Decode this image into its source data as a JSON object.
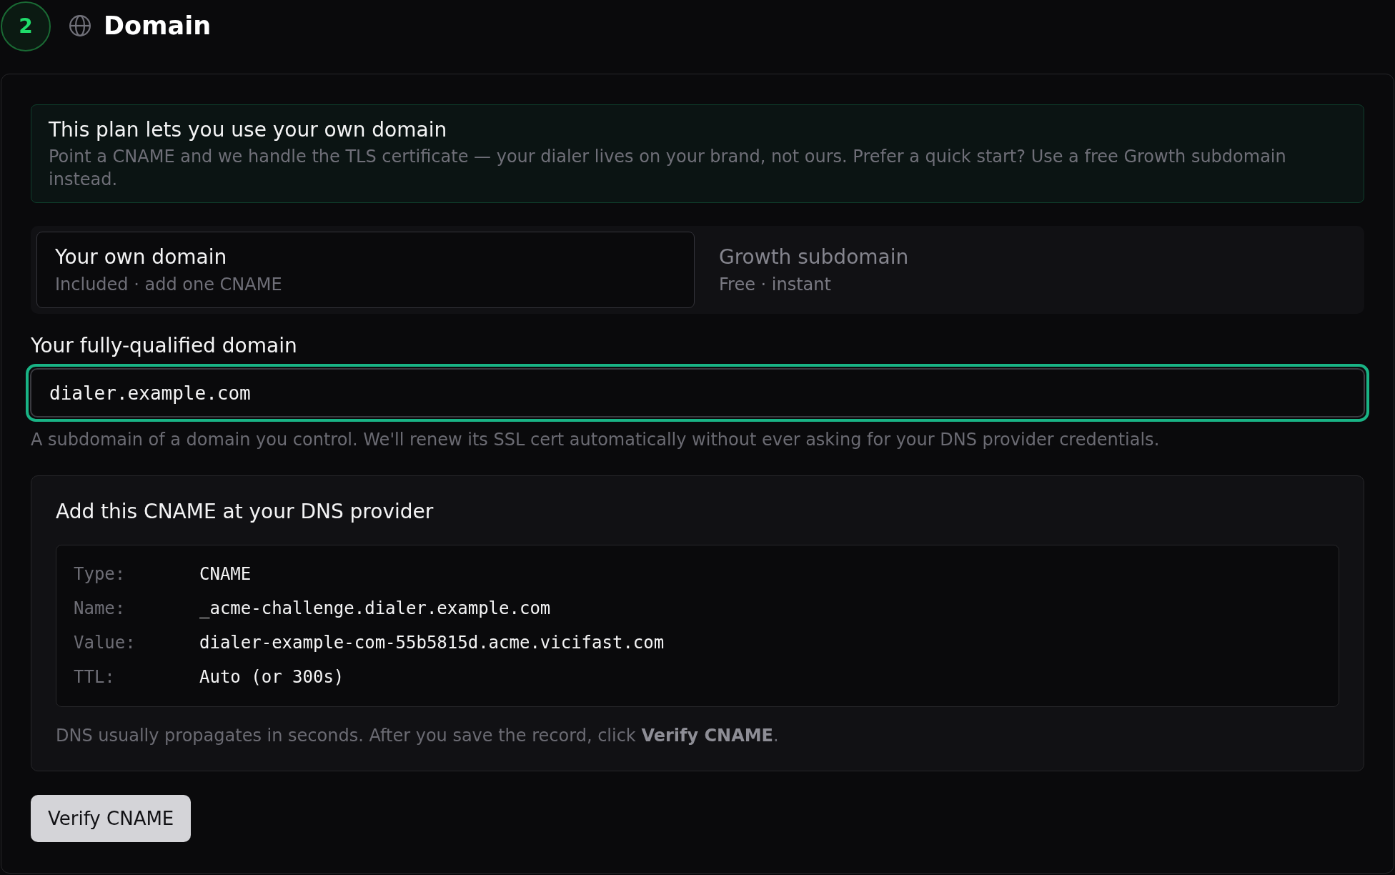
{
  "step": {
    "number": "2",
    "title": "Domain"
  },
  "notice": {
    "title": "This plan lets you use your own domain",
    "body": "Point a CNAME and we handle the TLS certificate — your dialer lives on your brand, not ours. Prefer a quick start? Use a free Growth subdomain instead."
  },
  "options": [
    {
      "title": "Your own domain",
      "subtitle": "Included · add one CNAME",
      "selected": true
    },
    {
      "title": "Growth subdomain",
      "subtitle": "Free · instant",
      "selected": false
    }
  ],
  "domain_field": {
    "label": "Your fully-qualified domain",
    "value": "dialer.example.com",
    "focused": true,
    "help": "A subdomain of a domain you control. We'll renew its SSL cert automatically without ever asking for your DNS provider credentials."
  },
  "dns_record": {
    "title": "Add this CNAME at your DNS provider",
    "rows": [
      {
        "label": "Type:",
        "value": "CNAME"
      },
      {
        "label": "Name:",
        "value": "_acme-challenge.dialer.example.com"
      },
      {
        "label": "Value:",
        "value": "dialer-example-com-55b5815d.acme.vicifast.com"
      },
      {
        "label": "TTL:",
        "value": "Auto (or 300s)"
      }
    ],
    "note": "DNS usually propagates in seconds. After you save the record, click **Verify CNAME**."
  },
  "verify_button": {
    "label": "Verify CNAME"
  }
}
